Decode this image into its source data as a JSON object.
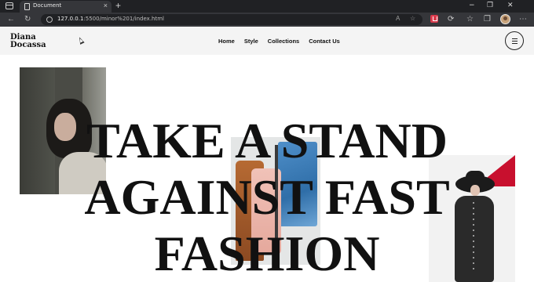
{
  "browser": {
    "tab_title": "Document",
    "tab_close": "×",
    "new_tab": "+",
    "url_host": "127.0.0.1",
    "url_rest": ":5500/minor%201/index.html",
    "window_controls": {
      "minimize": "−",
      "maximize": "❐",
      "close": "✕"
    },
    "toolbar_more": "⋯"
  },
  "site": {
    "logo_line1": "Diana",
    "logo_line2": "Docassa",
    "nav": [
      {
        "label": "Home"
      },
      {
        "label": "Style"
      },
      {
        "label": "Collections"
      },
      {
        "label": "Contact Us"
      }
    ]
  },
  "hero": {
    "headline_lines": [
      "TAKE A STAND",
      "AGAINST FAST",
      "FASHION"
    ]
  },
  "colors": {
    "accent_red": "#c8102e",
    "header_bg": "#f4f4f4",
    "text": "#111111"
  }
}
